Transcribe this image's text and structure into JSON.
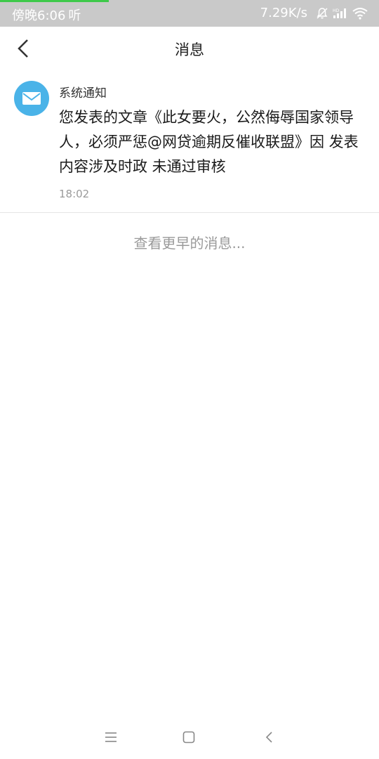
{
  "status_bar": {
    "time": "傍晚6:06",
    "listen_label": "听",
    "network_speed": "7.29K/s",
    "icons": [
      "mute-bell-icon",
      "hd-signal-icon",
      "wifi-icon"
    ]
  },
  "header": {
    "title": "消息",
    "back_icon": "chevron-left-icon"
  },
  "messages": [
    {
      "sender": "系统通知",
      "avatar_icon": "mail-icon",
      "avatar_color": "#4ab3e8",
      "body": "您发表的文章《此女要火，公然侮辱国家领导人，必须严惩@网贷逾期反催收联盟》因 发表内容涉及时政  未通过审核",
      "time": "18:02"
    }
  ],
  "load_earlier": "查看更早的消息...",
  "nav_bar": {
    "icons": [
      "menu-icon",
      "home-square-icon",
      "back-chevron-icon"
    ]
  },
  "colors": {
    "status_bar_bg": "#c9c9c9",
    "progress": "#3ec94a",
    "muted_text": "#9a9a9a"
  }
}
